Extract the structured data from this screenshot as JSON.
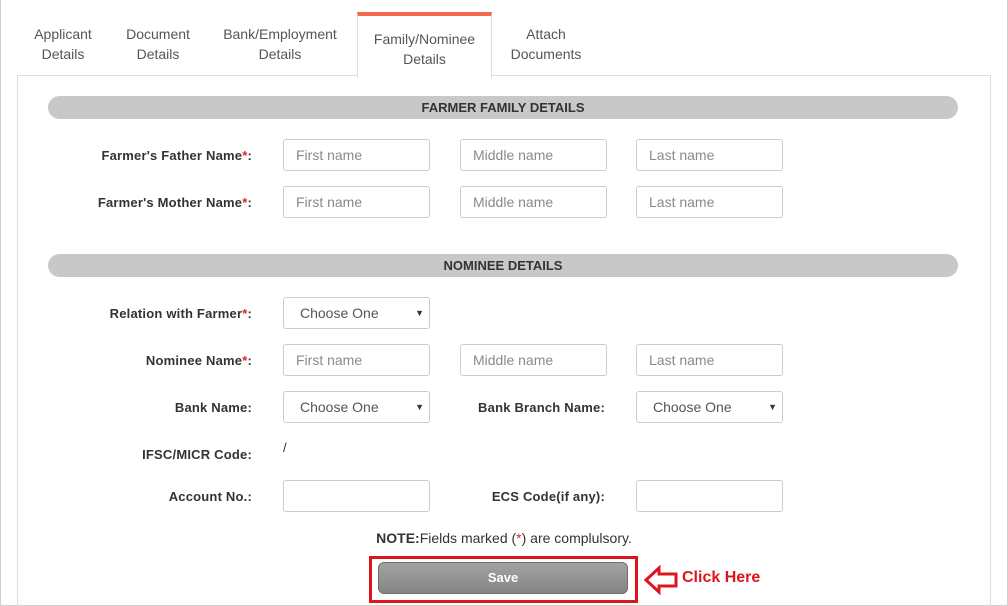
{
  "tabs": [
    {
      "line1": "Applicant",
      "line2": "Details"
    },
    {
      "line1": "Document",
      "line2": "Details"
    },
    {
      "line1": "Bank/Employment",
      "line2": "Details"
    },
    {
      "line1": "Family/Nominee",
      "line2": "Details"
    },
    {
      "line1": "Attach",
      "line2": "Documents"
    }
  ],
  "family": {
    "heading": "FARMER FAMILY DETAILS",
    "father_label": "Farmer's Father Name",
    "mother_label": "Farmer's Mother Name",
    "required_mark": "*",
    "colon": ":",
    "placeholders": {
      "first": "First name",
      "middle": "Middle name",
      "last": "Last name"
    }
  },
  "nominee": {
    "heading": "NOMINEE DETAILS",
    "relation_label": "Relation with Farmer",
    "relation_value": "Choose One",
    "name_label": "Nominee Name",
    "bank_label": "Bank Name:",
    "bank_value": "Choose One",
    "branch_label": "Bank Branch Name:",
    "branch_value": "Choose One",
    "ifsc_label": "IFSC/MICR Code:",
    "ifsc_value": "/",
    "account_label": "Account No.:",
    "ecs_label": "ECS Code(if any):"
  },
  "note": {
    "prefix": "NOTE:",
    "text_before": "Fields marked (",
    "mark": "*",
    "text_after": ") are complulsory."
  },
  "save_label": "Save",
  "annotation": {
    "text": "Click Here",
    "color": "#e0141e"
  },
  "icons": {
    "caret": "▼"
  },
  "colors": {
    "active_tab": "#f26a50",
    "section_bar": "#c8c8c8",
    "required": "#d9262b"
  }
}
